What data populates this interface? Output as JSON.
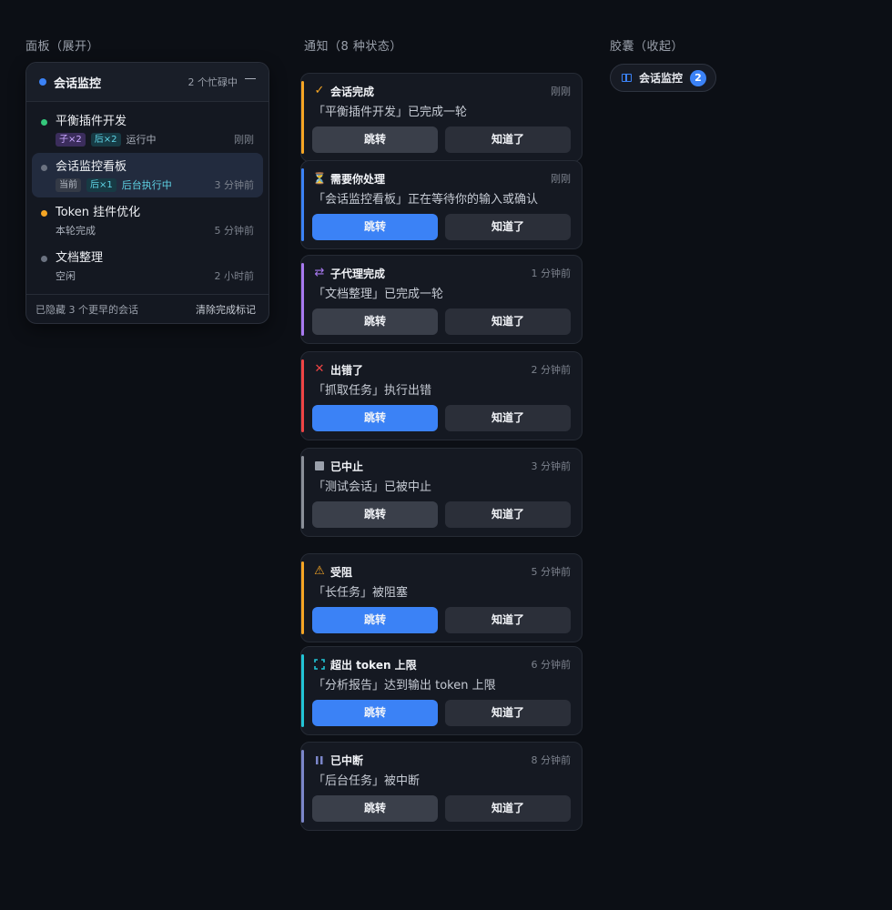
{
  "sections": {
    "panel": "面板（展开）",
    "notifications": "通知（8 种状态）",
    "capsule": "胶囊（收起）"
  },
  "panel": {
    "title": "会话监控",
    "busy": "2 个忙碌中",
    "sessions": [
      {
        "title": "平衡插件开发",
        "tags": [
          "子×2",
          "后×2"
        ],
        "status": "运行中",
        "time": "刚刚",
        "dot": "#34c77b"
      },
      {
        "title": "会话监控看板",
        "tags": [
          "当前",
          "后×1"
        ],
        "status": "后台执行中",
        "time": "3 分钟前",
        "dot": "#6b7280"
      },
      {
        "title": "Token 挂件优化",
        "status": "本轮完成",
        "time": "5 分钟前",
        "dot": "#f5a524"
      },
      {
        "title": "文档整理",
        "status": "空闲",
        "time": "2 小时前",
        "dot": "#6b7280"
      }
    ],
    "footer_hidden": "已隐藏 3 个更早的会话",
    "footer_clear": "清除完成标记"
  },
  "notifications": [
    {
      "icon": "check-icon",
      "glyph": "✓",
      "color": "#f5a524",
      "title": "会话完成",
      "time": "刚刚",
      "message": "「平衡插件开发」已完成一轮",
      "primary": false
    },
    {
      "icon": "hourglass-icon",
      "glyph": "⏳",
      "color": "#3b82f6",
      "title": "需要你处理",
      "time": "刚刚",
      "message": "「会话监控看板」正在等待你的输入或确认",
      "primary": true
    },
    {
      "icon": "swap-icon",
      "glyph": "⇄",
      "color": "#a879f0",
      "title": "子代理完成",
      "time": "1 分钟前",
      "message": "「文档整理」已完成一轮",
      "primary": false
    },
    {
      "icon": "error-x-icon",
      "glyph": "✕",
      "color": "#ef4444",
      "title": "出错了",
      "time": "2 分钟前",
      "message": "「抓取任务」执行出错",
      "primary": true
    },
    {
      "icon": "stop-square-icon",
      "glyph": "■",
      "color": "#8b9099",
      "title": "已中止",
      "time": "3 分钟前",
      "message": "「测试会话」已被中止",
      "primary": false
    },
    {
      "icon": "warning-icon",
      "glyph": "⚠",
      "color": "#f5a524",
      "title": "受阻",
      "time": "5 分钟前",
      "message": "「长任务」被阻塞",
      "primary": true
    },
    {
      "icon": "expand-icon",
      "glyph": "⛶",
      "color": "#22c5d6",
      "title": "超出 token 上限",
      "time": "6 分钟前",
      "message": "「分析报告」达到输出 token 上限",
      "primary": true
    },
    {
      "icon": "pause-icon",
      "glyph": "⏸",
      "color": "#7b86c9",
      "title": "已中断",
      "time": "8 分钟前",
      "message": "「后台任务」被中断",
      "primary": false
    }
  ],
  "buttons": {
    "go": "跳转",
    "ack": "知道了"
  },
  "capsule": {
    "label": "会话监控",
    "count": "2"
  }
}
